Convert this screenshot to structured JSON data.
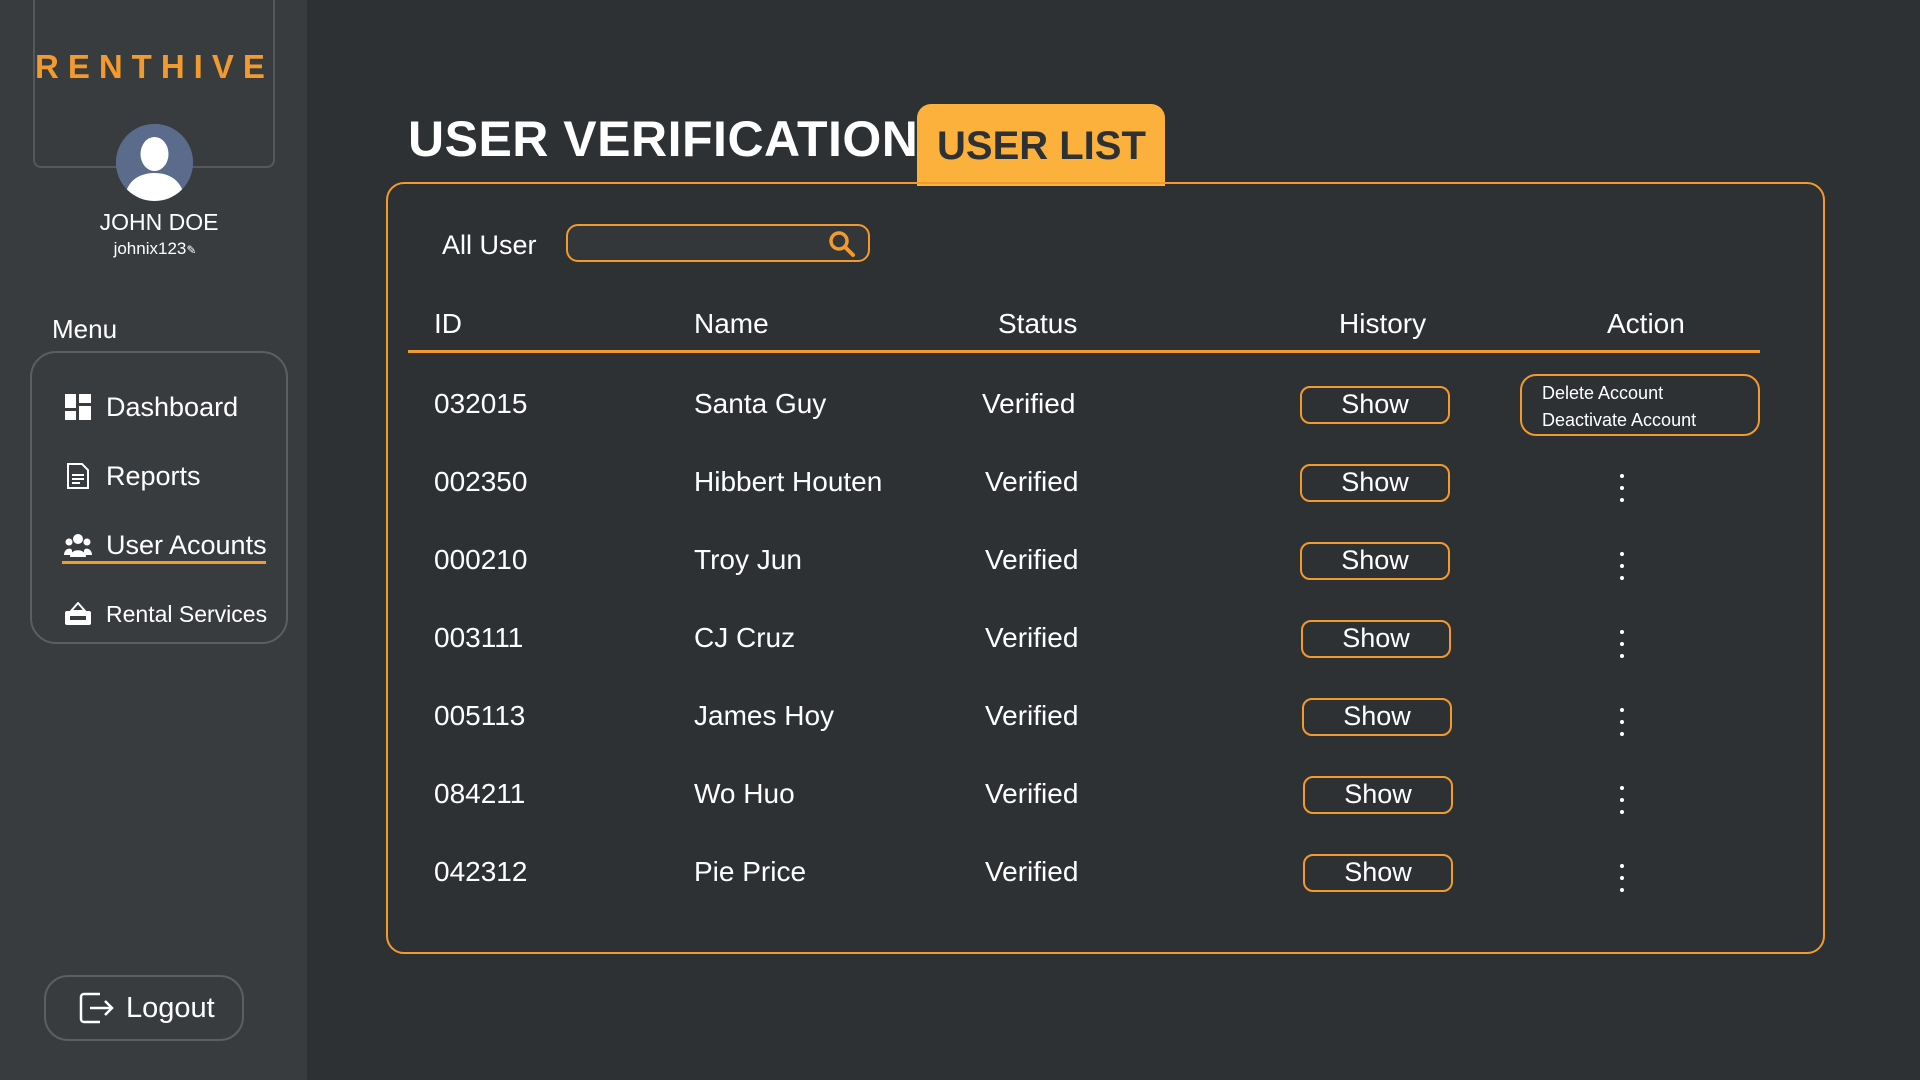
{
  "brand": "RENTHIVE",
  "user": {
    "name": "JOHN DOE",
    "handle": "johnix123"
  },
  "menu": {
    "label": "Menu",
    "items": [
      {
        "label": "Dashboard",
        "icon": "dashboard-icon"
      },
      {
        "label": "Reports",
        "icon": "report-icon"
      },
      {
        "label": "User Acounts",
        "icon": "users-icon"
      },
      {
        "label": "Rental Services",
        "icon": "rent-sign-icon"
      }
    ],
    "active": "User Acounts"
  },
  "logout": {
    "label": "Logout",
    "icon": "logout-icon"
  },
  "page": {
    "title": "USER VERIFICATION",
    "tab": "USER LIST"
  },
  "filter": {
    "label": "All User",
    "placeholder": "",
    "value": ""
  },
  "table": {
    "headers": {
      "id": "ID",
      "name": "Name",
      "status": "Status",
      "history": "History",
      "action": "Action"
    },
    "rows": [
      {
        "id": "032015",
        "name": "Santa Guy",
        "status": "Verified",
        "history": "Show"
      },
      {
        "id": "002350",
        "name": "Hibbert Houten",
        "status": "Verified",
        "history": "Show"
      },
      {
        "id": "000210",
        "name": "Troy Jun",
        "status": "Verified",
        "history": "Show"
      },
      {
        "id": "003111",
        "name": "CJ Cruz",
        "status": "Verified",
        "history": "Show"
      },
      {
        "id": "005113",
        "name": "James Hoy",
        "status": "Verified",
        "history": "Show"
      },
      {
        "id": "084211",
        "name": "Wo Huo",
        "status": "Verified",
        "history": "Show"
      },
      {
        "id": "042312",
        "name": "Pie Price",
        "status": "Verified",
        "history": "Show"
      }
    ],
    "action_menu": [
      "Delete Account",
      "Deactivate Account"
    ]
  },
  "colors": {
    "accent": "#f29a2e",
    "tab": "#fbb13c",
    "background": "#2e3134",
    "sidebar": "#393c3f"
  }
}
